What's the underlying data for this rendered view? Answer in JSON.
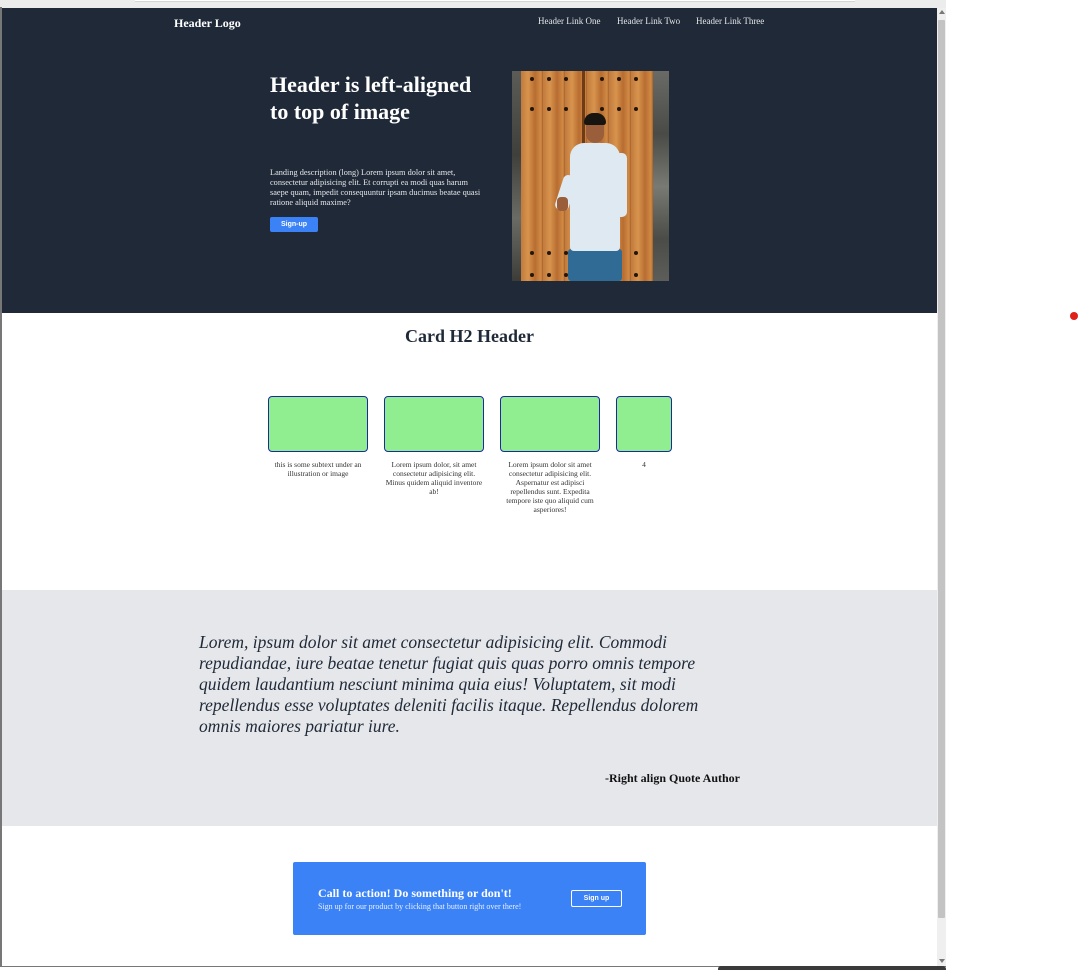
{
  "header": {
    "logo": "Header Logo",
    "links": [
      "Header Link One",
      "Header Link Two",
      "Header Link Three"
    ]
  },
  "hero": {
    "title": "Header is left-aligned to top of image",
    "description": "Landing description (long) Lorem ipsum dolor sit amet, consectetur adipisicing elit. Et corrupti ea modi quas harum saepe quam, impedit consequuntur ipsam ducimus beatae quasi ratione aliquid maxime?",
    "button_label": "Sign-up"
  },
  "cards": {
    "title": "Card H2 Header",
    "items": [
      {
        "text": "this is some subtext under an illustration or image"
      },
      {
        "text": "Lorem ipsum dolor, sit amet consectetur adipisicing elit. Minus quidem aliquid inventore ab!"
      },
      {
        "text": "Lorem ipsum dolor sit amet consectetur adipisicing elit. Aspernatur est adipisci repellendus sunt. Expedita tempore iste quo aliquid cum asperiores!"
      },
      {
        "text": "4"
      }
    ]
  },
  "quote": {
    "text": "Lorem, ipsum dolor sit amet consectetur adipisicing elit. Commodi repudiandae, iure beatae tenetur fugiat quis quas porro omnis tempore quidem laudantium nesciunt minima quia eius! Voluptatem, sit modi repellendus esse voluptates deleniti facilis itaque. Repellendus dolorem omnis maiores pariatur iure.",
    "author": "-Right align Quote Author"
  },
  "cta": {
    "title": "Call to action! Do something or don't!",
    "subtitle": "Sign up for our product by clicking that button right over there!",
    "button_label": "Sign up"
  },
  "colors": {
    "hero_bg": "#1f2937",
    "accent": "#3b82f6",
    "card_fill": "#90ee90",
    "quote_bg": "#e5e7eb"
  }
}
